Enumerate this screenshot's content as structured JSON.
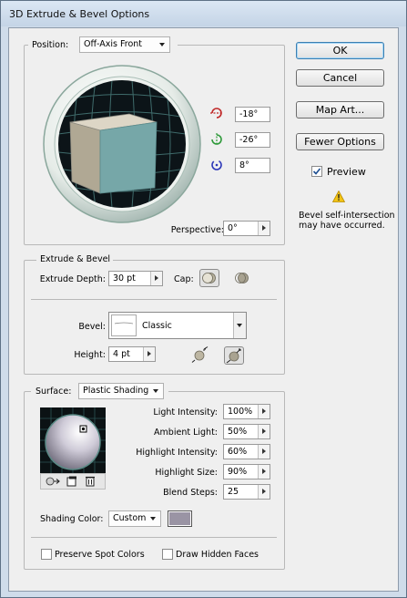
{
  "window": {
    "title": "3D Extrude & Bevel Options"
  },
  "position": {
    "label": "Position:",
    "preset": "Off-Axis Front",
    "rotations": [
      "-18°",
      "-26°",
      "8°"
    ],
    "perspective_label": "Perspective:",
    "perspective_value": "0°"
  },
  "buttons": {
    "ok": "OK",
    "cancel": "Cancel",
    "map_art": "Map Art...",
    "fewer_options": "Fewer Options"
  },
  "preview": {
    "label": "Preview",
    "checked": true
  },
  "warning": {
    "line1": "Bevel self-intersection",
    "line2": "may have occurred."
  },
  "extrude_bevel": {
    "section_label": "Extrude & Bevel",
    "extrude_depth_label": "Extrude Depth:",
    "extrude_depth_value": "30 pt",
    "cap_label": "Cap:",
    "bevel_label": "Bevel:",
    "bevel_value": "Classic",
    "height_label": "Height:",
    "height_value": "4 pt"
  },
  "surface": {
    "label": "Surface:",
    "value": "Plastic Shading",
    "light_intensity_label": "Light Intensity:",
    "light_intensity_value": "100%",
    "ambient_light_label": "Ambient Light:",
    "ambient_light_value": "50%",
    "highlight_intensity_label": "Highlight Intensity:",
    "highlight_intensity_value": "60%",
    "highlight_size_label": "Highlight Size:",
    "highlight_size_value": "90%",
    "blend_steps_label": "Blend Steps:",
    "blend_steps_value": "25",
    "shading_color_label": "Shading Color:",
    "shading_color_value": "Custom",
    "shading_swatch_color": "#9a94a4",
    "preserve_spot_label": "Preserve Spot Colors",
    "draw_hidden_label": "Draw Hidden Faces"
  },
  "icons": [
    "x-axis-rotate-icon",
    "y-axis-rotate-icon",
    "z-axis-rotate-icon",
    "cap-on-icon",
    "cap-off-icon",
    "bevel-extent-in-icon",
    "bevel-extent-out-icon",
    "move-light-back-icon",
    "new-light-icon",
    "delete-light-icon",
    "warning-icon"
  ]
}
